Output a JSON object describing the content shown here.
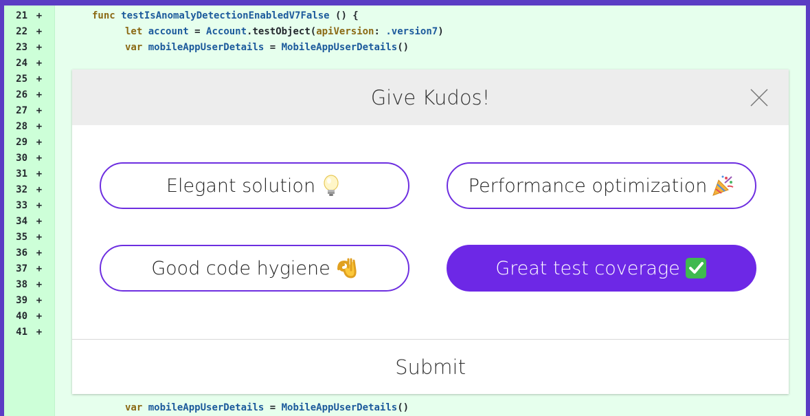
{
  "diff": {
    "line_numbers": [
      "21",
      "22",
      "23",
      "24",
      "25",
      "26",
      "27",
      "28",
      "29",
      "30",
      "31",
      "32",
      "33",
      "34",
      "35",
      "36",
      "37",
      "38",
      "39",
      "40",
      "41"
    ],
    "marker": "+",
    "code_line_21": {
      "kw": "func",
      "name": " testIsAnomalyDetectionEnabledV7False",
      "rest": " () {"
    },
    "code_line_22": {
      "kw": "let",
      "var": " account",
      "eq": " = ",
      "type": "Account",
      "call": ".testObject(",
      "param": "apiVersion",
      "colon": ": ",
      "value": ".version7",
      "close": ")"
    },
    "code_line_23": {
      "kw": "var",
      "var": " mobileAppUserDetails",
      "eq": " = ",
      "type": "MobileAppUserDetails",
      "close": "()"
    },
    "code_line_41": {
      "kw": "var",
      "var": " mobileAppUserDetails",
      "eq": " = ",
      "type": "MobileAppUserDetails",
      "close": "()"
    }
  },
  "modal": {
    "title": "Give Kudos!",
    "options": [
      {
        "label": "Elegant solution",
        "emoji": "lightbulb-icon",
        "selected": false
      },
      {
        "label": "Performance optimization",
        "emoji": "party-popper-icon",
        "selected": false
      },
      {
        "label": "Good code hygiene",
        "emoji": "ok-hand-icon",
        "selected": false
      },
      {
        "label": "Great test coverage",
        "emoji": "check-mark-icon",
        "selected": true
      }
    ],
    "submit_label": "Submit"
  },
  "colors": {
    "frame": "#5b3cc4",
    "accent": "#6d28e6",
    "diff_bg": "#e6ffed",
    "gutter_bg": "#cdffd8"
  }
}
